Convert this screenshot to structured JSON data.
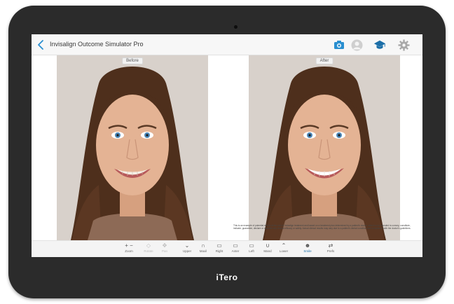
{
  "app": {
    "title": "Invisalign Outcome Simulator Pro",
    "brand": "iTero"
  },
  "titlebar_icons": [
    {
      "name": "camera-icon",
      "color": "#2a8fd0"
    },
    {
      "name": "user-avatar-icon",
      "color": "#b8b8b8"
    },
    {
      "name": "graduation-cap-icon",
      "color": "#1c6fa8"
    },
    {
      "name": "gear-icon",
      "color": "#a9a9a9"
    }
  ],
  "panels": {
    "before_label": "Before",
    "after_label": "After"
  },
  "disclaimer": "This is an example of potential results at the end of Invisalign treatment and based on a treatment plan determined by a patient's doctor, which is not intended to convey, constitute, indicate, guarantee, declare or describe any clinical efficacy or safety. Actual clinical results may vary due to a patient's dental condition and compliance with the doctor's guidelines.",
  "toolbar": {
    "zoom": {
      "glyph": "+  −",
      "label": "Zoom"
    },
    "rotate": {
      "glyph": "◇",
      "label": "Rotate"
    },
    "pan": {
      "glyph": "✥",
      "label": "Pan"
    },
    "upper": {
      "glyph": "⌄",
      "label": "Upper"
    },
    "maxil": {
      "glyph": "∩",
      "label": "Maxil"
    },
    "right": {
      "glyph": "▭",
      "label": "Right"
    },
    "anter": {
      "glyph": "▭",
      "label": "Anter"
    },
    "left": {
      "glyph": "▭",
      "label": "Left"
    },
    "mand": {
      "glyph": "∪",
      "label": "Mand"
    },
    "lower": {
      "glyph": "⌃",
      "label": "Lower"
    },
    "smile": {
      "glyph": "☻",
      "label": "Smile"
    },
    "prefs": {
      "glyph": "⇄",
      "label": "Prefs"
    }
  },
  "colors": {
    "accent": "#1c8ad4",
    "device_frame": "#2b2b2b"
  }
}
